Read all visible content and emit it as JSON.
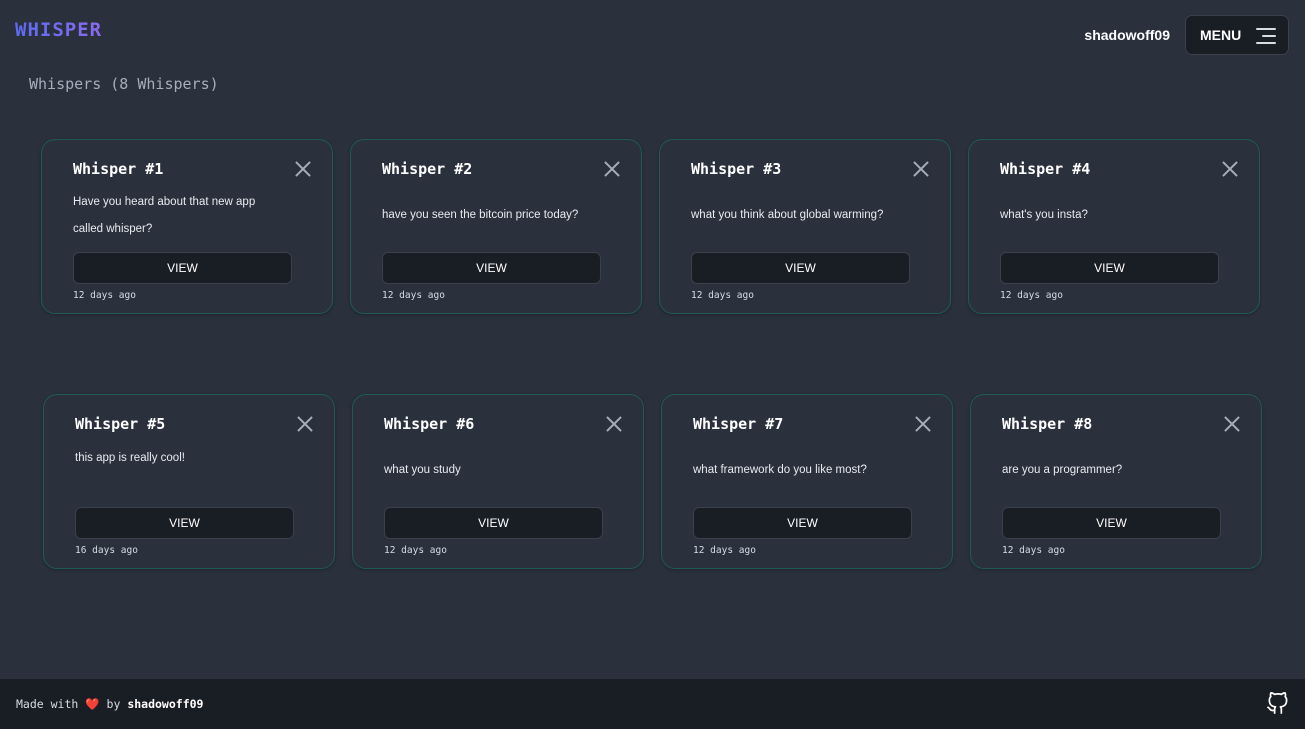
{
  "header": {
    "logo": "WHISPER",
    "username": "shadowoff09",
    "menu_label": "MENU",
    "menu_icon": "hamburger-icon"
  },
  "main": {
    "heading": "Whispers (8 Whispers)",
    "view_label": "VIEW",
    "close_icon": "close-icon",
    "whispers": [
      {
        "title": "Whisper #1",
        "message": "Have you heard about that new app called whisper?",
        "time": "12 days ago"
      },
      {
        "title": "Whisper #2",
        "message": "have you seen the bitcoin price today?",
        "time": "12 days ago"
      },
      {
        "title": "Whisper #3",
        "message": "what you think about global warming?",
        "time": "12 days ago"
      },
      {
        "title": "Whisper #4",
        "message": "what's you insta?",
        "time": "12 days ago"
      },
      {
        "title": "Whisper #5",
        "message": "this app is really cool!",
        "time": "16 days ago"
      },
      {
        "title": "Whisper #6",
        "message": "what you study",
        "time": "12 days ago"
      },
      {
        "title": "Whisper #7",
        "message": "what framework do you like most?",
        "time": "12 days ago"
      },
      {
        "title": "Whisper #8",
        "message": "are you a programmer?",
        "time": "12 days ago"
      }
    ]
  },
  "footer": {
    "made_with": "Made with",
    "heart": "❤️",
    "by": "by",
    "author": "shadowoff09",
    "github_icon": "github-icon"
  },
  "colors": {
    "background": "#2a303c",
    "surface": "#191d24",
    "card_border": "#1f5a57",
    "logo_gradient_start": "#5b6cf2",
    "logo_gradient_end": "#8a6bf0",
    "heart": "#e0334c"
  }
}
